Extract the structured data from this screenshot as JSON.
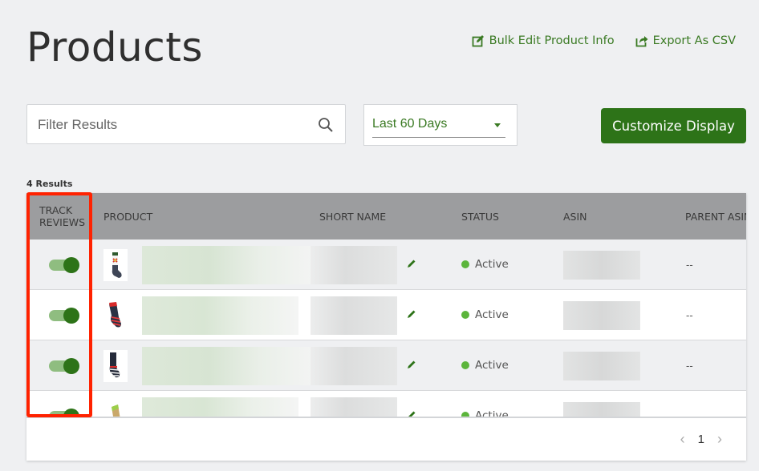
{
  "header": {
    "title": "Products",
    "links": [
      {
        "label": "Bulk Edit Product Info",
        "icon": "edit-square-icon"
      },
      {
        "label": "Export As CSV",
        "icon": "export-share-icon"
      }
    ]
  },
  "filters": {
    "search_placeholder": "Filter Results",
    "search_value": "",
    "date_range": "Last 60 Days",
    "customize_label": "Customize Display"
  },
  "results_count": "4 Results",
  "table": {
    "columns": [
      "TRACK REVIEWS",
      "PRODUCT",
      "SHORT NAME",
      "STATUS",
      "ASIN",
      "PARENT ASIN"
    ],
    "rows": [
      {
        "track_reviews": true,
        "product": "[redacted]",
        "short_name": "[redacted]",
        "status": "Active",
        "asin": "[redacted]",
        "parent_asin": "--"
      },
      {
        "track_reviews": true,
        "product": "[redacted]",
        "short_name": "[redacted]",
        "status": "Active",
        "asin": "[redacted]",
        "parent_asin": "--"
      },
      {
        "track_reviews": true,
        "product": "[redacted]",
        "short_name": "[redacted]",
        "status": "Active",
        "asin": "[redacted]",
        "parent_asin": "--"
      },
      {
        "track_reviews": true,
        "product": "[redacted]",
        "short_name": "[redacted]",
        "status": "Active",
        "asin": "[redacted]",
        "parent_asin": ""
      }
    ]
  },
  "pagination": {
    "current_page": "1",
    "prev": "‹",
    "next": "›"
  },
  "colors": {
    "brand_green": "#2d7318",
    "status_active": "#5cb53c",
    "highlight": "#ff2200"
  }
}
